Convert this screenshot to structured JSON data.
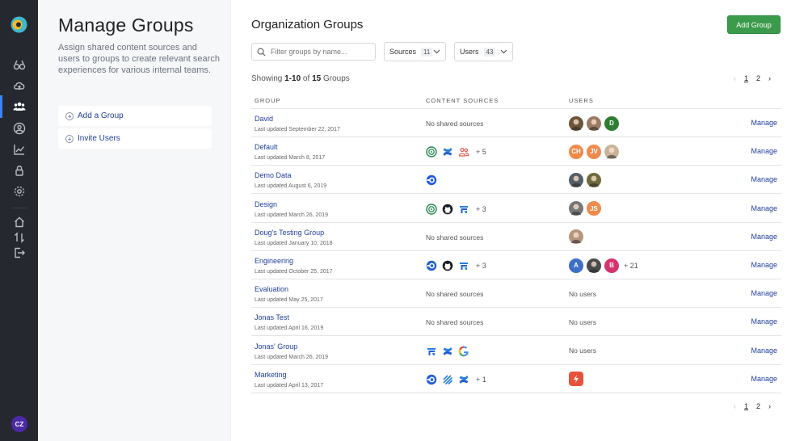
{
  "rail": {
    "items": [
      {
        "icon": "binoculars-icon"
      },
      {
        "icon": "cloud-upload-icon"
      },
      {
        "icon": "users-group-icon",
        "active": true
      },
      {
        "icon": "user-circle-icon"
      },
      {
        "icon": "chart-line-icon"
      },
      {
        "icon": "lock-icon"
      },
      {
        "icon": "gear-icon"
      },
      {
        "icon": "home-icon"
      },
      {
        "icon": "swap-icon"
      },
      {
        "icon": "sign-out-icon"
      }
    ],
    "user_initials": "CZ"
  },
  "panel": {
    "title": "Manage Groups",
    "description": "Assign shared content sources and users to groups to create relevant search experiences for various internal teams.",
    "actions": [
      "Add a Group",
      "Invite Users"
    ]
  },
  "main": {
    "title": "Organization Groups",
    "add_button": "Add Group",
    "search_placeholder": "Filter groups by name...",
    "filters": {
      "sources": {
        "label": "Sources",
        "count": "11"
      },
      "users": {
        "label": "Users",
        "count": "43"
      }
    },
    "showing": {
      "prefix": "Showing ",
      "range": "1-10",
      "of": " of ",
      "total": "15",
      "suffix": " Groups"
    },
    "pages": [
      "1",
      "2"
    ],
    "columns": [
      "GROUP",
      "CONTENT SOURCES",
      "USERS"
    ],
    "manage_label": "Manage",
    "no_sources_text": "No shared sources",
    "no_users_text": "No users",
    "rows": [
      {
        "name": "David",
        "updated": "Last updated September 22, 2017",
        "sources": [],
        "sources_more": "",
        "users": [
          {
            "type": "photo",
            "color": "#6b5438"
          },
          {
            "type": "photo",
            "color": "#9a7a62"
          },
          {
            "type": "initial",
            "text": "D",
            "color": "#2e7d32"
          }
        ],
        "users_more": ""
      },
      {
        "name": "Default",
        "updated": "Last updated March 8, 2017",
        "sources": [
          "green-circle",
          "confluence",
          "people"
        ],
        "sources_more": "+ 5",
        "users": [
          {
            "type": "initial",
            "text": "CH",
            "color": "#f08a4b"
          },
          {
            "type": "initial",
            "text": "JV",
            "color": "#f08a4b"
          },
          {
            "type": "photo",
            "color": "#c9b49a"
          }
        ],
        "users_more": ""
      },
      {
        "name": "Demo Data",
        "updated": "Last updated August 6, 2019",
        "sources": [
          "blue-o"
        ],
        "sources_more": "",
        "users": [
          {
            "type": "photo",
            "color": "#555e66"
          },
          {
            "type": "photo",
            "color": "#6e6a3a"
          }
        ],
        "users_more": ""
      },
      {
        "name": "Design",
        "updated": "Last updated March 26, 2019",
        "sources": [
          "green-circle",
          "github",
          "jira"
        ],
        "sources_more": "+ 3",
        "users": [
          {
            "type": "photo",
            "color": "#777"
          },
          {
            "type": "initial",
            "text": "JS",
            "color": "#f08a4b"
          }
        ],
        "users_more": ""
      },
      {
        "name": "Doug's Testing Group",
        "updated": "Last updated January 10, 2018",
        "sources": [],
        "sources_more": "",
        "users": [
          {
            "type": "photo",
            "color": "#b49680"
          }
        ],
        "users_more": ""
      },
      {
        "name": "Engineering",
        "updated": "Last updated October 25, 2017",
        "sources": [
          "blue-o",
          "github",
          "jira"
        ],
        "sources_more": "+ 3",
        "users": [
          {
            "type": "initial",
            "text": "A",
            "color": "#3f6fc6"
          },
          {
            "type": "photo",
            "color": "#4a4a4a"
          },
          {
            "type": "initial",
            "text": "B",
            "color": "#d6336c"
          }
        ],
        "users_more": "+ 21"
      },
      {
        "name": "Evaluation",
        "updated": "Last updated May 25, 2017",
        "sources": [],
        "sources_more": "",
        "users": [],
        "users_more": ""
      },
      {
        "name": "Jonas Test",
        "updated": "Last updated April 16, 2019",
        "sources": [],
        "sources_more": "",
        "users": [],
        "users_more": ""
      },
      {
        "name": "Jonas' Group",
        "updated": "Last updated March 26, 2019",
        "sources": [
          "jira",
          "confluence",
          "google"
        ],
        "sources_more": "",
        "users": [],
        "users_more": ""
      },
      {
        "name": "Marketing",
        "updated": "Last updated April 13, 2017",
        "sources": [
          "blue-o",
          "stripes",
          "confluence"
        ],
        "sources_more": "+ 1",
        "users": [
          {
            "type": "bolt",
            "color": "#e8523c"
          }
        ],
        "users_more": ""
      }
    ]
  },
  "colors": {
    "accent": "#1f3f9e",
    "primary_button": "#3c9a4c",
    "rail_bg": "#25282f"
  }
}
